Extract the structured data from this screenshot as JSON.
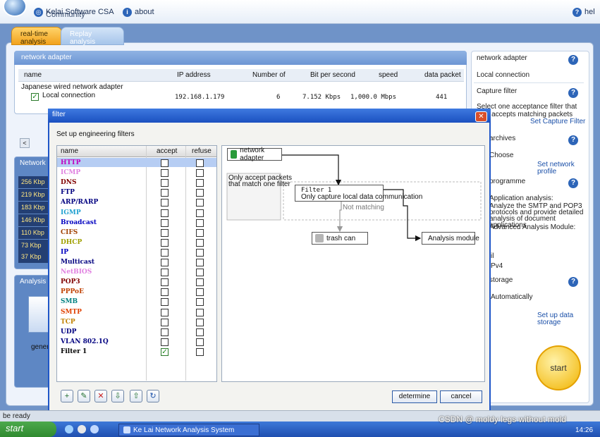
{
  "app": {
    "vendor": "Kelai Software CSA",
    "community": "Community",
    "about": "about",
    "help": "hel"
  },
  "tabs": [
    {
      "label": "real-time analysis",
      "active": true
    },
    {
      "label": "Replay analysis",
      "active": false
    }
  ],
  "adapter_panel": {
    "title": "network adapter",
    "columns": [
      "name",
      "IP address",
      "Number of",
      "Bit per second",
      "speed",
      "data packet"
    ],
    "group": "Japanese wired network adapter",
    "row": {
      "name": "Local connection",
      "ip": "192.168.1.179",
      "number": "6",
      "bps": "7.152 Kbps",
      "speed": "1,000.0 Mbps",
      "packets": "441",
      "checked": true
    }
  },
  "left_panels": {
    "network": "Network",
    "speeds": [
      "256 Kbp",
      "219 Kbp",
      "183 Kbp",
      "146 Kbp",
      "110 Kbp",
      "73 Kbp",
      "37 Kbp"
    ],
    "analysis": "Analysis",
    "generate": "genera"
  },
  "right_pane": {
    "network_adapter": "network adapter",
    "local_connection": "Local connection",
    "capture_filter": "Capture filter",
    "capture_desc": "Select one acceptance filter that only accepts matching packets",
    "set_capture_filter": "Set Capture Filter",
    "archives": "archives",
    "choose": "Choose",
    "set_network_profile": "Set network profile",
    "programme": "programme",
    "app_analysis": "Application analysis:",
    "app_analysis_desc": "Analyze the SMTP and POP3 protocols and provide detailed analysis of document applications",
    "advanced_module": "Advanced Analysis Module:",
    "il": "il",
    "pv4": "Pv4",
    "storage": "storage",
    "automatically": "Automatically",
    "set_up_data_storage": "Set up data storage",
    "start": "start"
  },
  "dialog": {
    "title": "filter",
    "subtitle": "Set up engineering filters",
    "columns": {
      "name": "name",
      "accept": "accept",
      "refuse": "refuse"
    },
    "filters": [
      {
        "name": "HTTP",
        "color": "#c000c0",
        "accept": false
      },
      {
        "name": "ICMP",
        "color": "#e080e0",
        "accept": false
      },
      {
        "name": "DNS",
        "color": "#800000",
        "accept": false
      },
      {
        "name": "FTP",
        "color": "#000080",
        "accept": false
      },
      {
        "name": "ARP/RARP",
        "color": "#000080",
        "accept": false
      },
      {
        "name": "IGMP",
        "color": "#20a0d0",
        "accept": false
      },
      {
        "name": "Broadcast",
        "color": "#0000c0",
        "accept": false
      },
      {
        "name": "CIFS",
        "color": "#a04000",
        "accept": false
      },
      {
        "name": "DHCP",
        "color": "#a0a000",
        "accept": false
      },
      {
        "name": "IP",
        "color": "#0000c0",
        "accept": false
      },
      {
        "name": "Multicast",
        "color": "#000080",
        "accept": false
      },
      {
        "name": "NetBIOS",
        "color": "#e080e0",
        "accept": false
      },
      {
        "name": "POP3",
        "color": "#800000",
        "accept": false
      },
      {
        "name": "PPPoE",
        "color": "#c04000",
        "accept": false
      },
      {
        "name": "SMB",
        "color": "#008080",
        "accept": false
      },
      {
        "name": "SMTP",
        "color": "#e04000",
        "accept": false
      },
      {
        "name": "TCP",
        "color": "#c08000",
        "accept": false
      },
      {
        "name": "UDP",
        "color": "#000080",
        "accept": false
      },
      {
        "name": "VLAN 802.1Q",
        "color": "#000080",
        "accept": false
      },
      {
        "name": "Filter 1",
        "color": "#000000",
        "accept": true
      }
    ],
    "canvas": {
      "network_adapter": "network adapter",
      "note": "Only accept packets that match one filter",
      "filter_name": "Filter 1",
      "filter_desc": "Only capture local data communication",
      "not_matching": "Not matching",
      "trash": "trash can",
      "analysis": "Analysis module"
    },
    "determine": "determine",
    "cancel": "cancel"
  },
  "status": "be ready",
  "taskbar": {
    "start": "start",
    "task": "Ke Lai Network Analysis System",
    "time": "14:26"
  },
  "watermark": "CSDN @ moldy legs without mold"
}
